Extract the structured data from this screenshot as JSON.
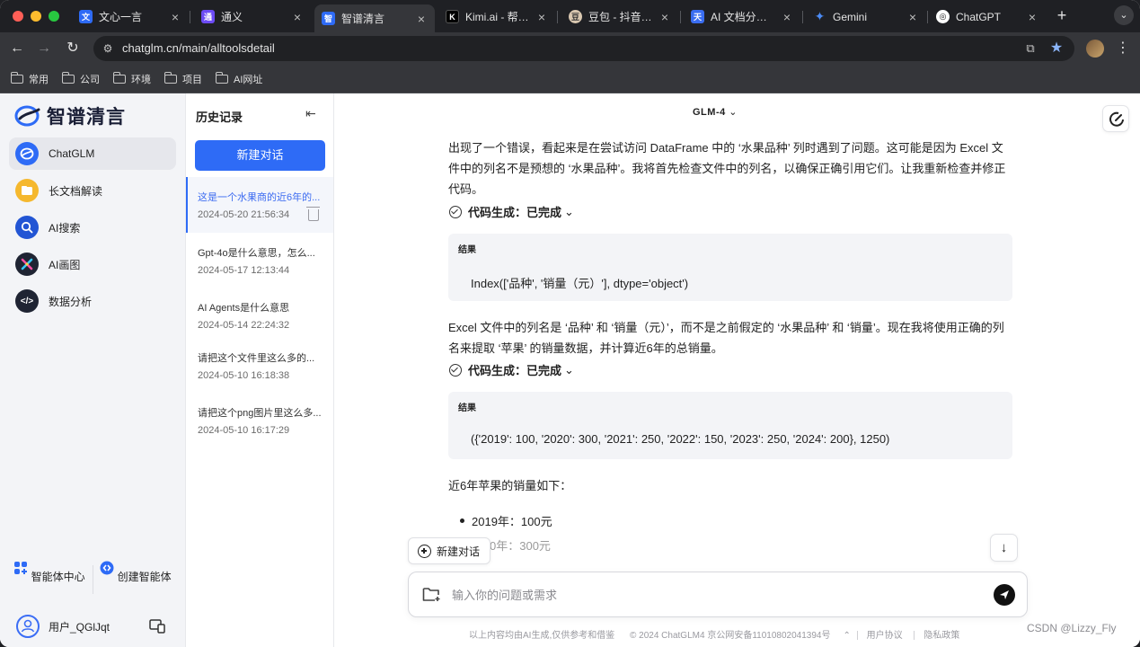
{
  "browser": {
    "tabs": [
      {
        "title": "文心一言",
        "fav_color": "#2e6bf6",
        "fav_icon": "wenxin-icon"
      },
      {
        "title": "通义",
        "fav_color": "#6c4bf5",
        "fav_icon": "tongyi-icon"
      },
      {
        "title": "智谱清言",
        "fav_color": "#2e6bf6",
        "fav_icon": "zhipu-icon",
        "active": true
      },
      {
        "title": "Kimi.ai - 帮你看",
        "fav_color": "#000000",
        "fav_icon": "kimi-icon"
      },
      {
        "title": "豆包 - 抖音旗下",
        "fav_color": "#d9c7b0",
        "fav_icon": "doubao-icon"
      },
      {
        "title": "AI 文档分析_天",
        "fav_color": "#3a6df0",
        "fav_icon": "tiangong-icon"
      },
      {
        "title": "Gemini",
        "fav_color": "#4b8bf5",
        "fav_icon": "gemini-icon"
      },
      {
        "title": "ChatGPT",
        "fav_color": "#ffffff",
        "fav_icon": "chatgpt-icon"
      }
    ],
    "url": "chatglm.cn/main/alltoolsdetail",
    "bookmarks": [
      "常用",
      "公司",
      "环境",
      "项目",
      "AI网址"
    ]
  },
  "sidebar": {
    "logo_text": "智谱清言",
    "items": [
      {
        "label": "ChatGLM",
        "icon": "chatglm-icon",
        "color": "#2e6bf6",
        "active": true
      },
      {
        "label": "长文档解读",
        "icon": "document-icon",
        "color": "#f5b82e"
      },
      {
        "label": "AI搜索",
        "icon": "search-icon",
        "color": "#2255d4"
      },
      {
        "label": "AI画图",
        "icon": "image-icon",
        "color": "#1f2433"
      },
      {
        "label": "数据分析",
        "icon": "code-icon",
        "color": "#1f2433"
      }
    ],
    "tools": [
      {
        "label": "智能体中心",
        "icon": "agents-icon"
      },
      {
        "label": "创建智能体",
        "icon": "create-agent-icon"
      }
    ],
    "user": "用户_QGlJqt"
  },
  "history": {
    "title": "历史记录",
    "new_chat": "新建对话",
    "items": [
      {
        "title": "这是一个水果商的近6年的...",
        "date": "2024-05-20 21:56:34",
        "active": true
      },
      {
        "title": "Gpt-4o是什么意思，怎么...",
        "date": "2024-05-17 12:13:44"
      },
      {
        "title": "AI Agents是什么意思",
        "date": "2024-05-14 22:24:32"
      },
      {
        "title": "请把这个文件里这么多的...",
        "date": "2024-05-10 16:18:38"
      },
      {
        "title": "请把这个png图片里这么多...",
        "date": "2024-05-10 16:17:29"
      }
    ]
  },
  "main": {
    "model": "GLM-4",
    "para1": "出现了一个错误，看起来是在尝试访问 DataFrame 中的 ‘水果品种’ 列时遇到了问题。这可能是因为 Excel 文件中的列名不是预想的 ‘水果品种’。我将首先检查文件中的列名，以确保正确引用它们。让我重新检查并修正代码。",
    "status1": "代码生成：已完成",
    "result_label": "结果",
    "result1": "Index(['品种', '销量（元）'], dtype='object')",
    "para2": "Excel 文件中的列名是 ‘品种’ 和 ‘销量（元）’，而不是之前假定的 ‘水果品种’ 和 ‘销量’。现在我将使用正确的列名来提取 ‘苹果’ 的销量数据，并计算近6年的总销量。",
    "status2": "代码生成：已完成",
    "result2": "({'2019': 100, '2020': 300, '2021': 250, '2022': 150, '2023': 250, '2024': 200}, 1250)",
    "summary": "近6年苹果的销量如下：",
    "list": [
      "2019年：100元",
      "0年：300元"
    ],
    "new_chat": "新建对话",
    "input_placeholder": "输入你的问题或需求",
    "footer": {
      "disclaimer": "以上内容均由AI生成,仅供参考和借鉴",
      "copyright": "© 2024 ChatGLM4 京公网安备11010802041394号",
      "terms": "用户协议",
      "privacy": "隐私政策"
    }
  },
  "watermark": "CSDN @Lizzy_Fly"
}
